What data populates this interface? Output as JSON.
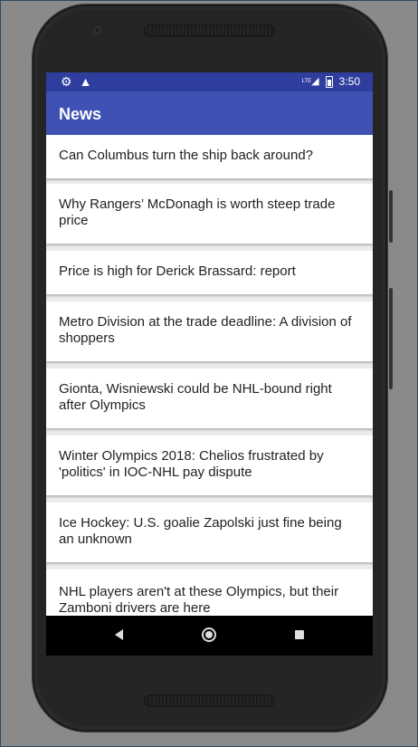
{
  "status_bar": {
    "left_icons": [
      "gear-icon",
      "warning-icon"
    ],
    "network": "LTE",
    "time": "3:50"
  },
  "app_bar": {
    "title": "News"
  },
  "news_items": [
    "Can Columbus turn the ship back around?",
    "Why Rangers’ McDonagh is worth steep trade price",
    "Price is high for Derick Brassard: report",
    "Metro Division at the trade deadline: A division of shoppers",
    "Gionta, Wisniewski could be NHL-bound right after Olympics",
    "Winter Olympics 2018: Chelios frustrated by 'politics' in IOC-NHL pay dispute",
    "Ice Hockey: U.S. goalie Zapolski just fine being an unknown",
    "NHL players aren't at these Olympics, but their Zamboni drivers are here"
  ],
  "nav_bar": {
    "buttons": [
      "back-icon",
      "home-icon",
      "recent-apps-icon"
    ]
  },
  "colors": {
    "status_bar": "#2f3e9e",
    "app_bar": "#3f51b5",
    "list_background": "#ebebeb"
  }
}
